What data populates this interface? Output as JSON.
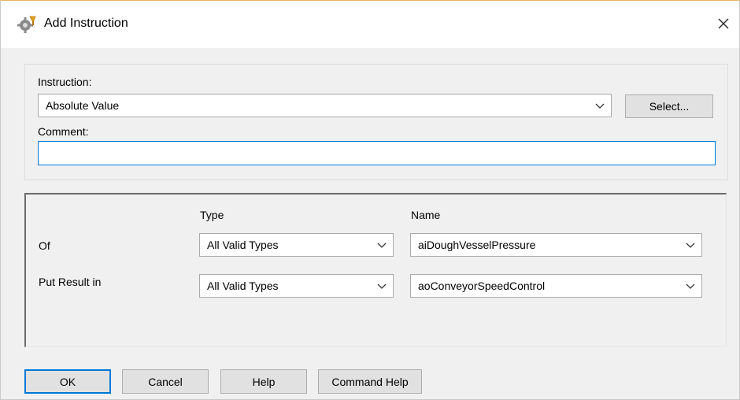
{
  "window": {
    "title": "Add Instruction",
    "icon": "instruction-gear-icon",
    "close_glyph": "✕"
  },
  "instruction_section": {
    "instruction_label": "Instruction:",
    "instruction_value": "Absolute Value",
    "select_button_label": "Select...",
    "comment_label": "Comment:",
    "comment_value": ""
  },
  "parameters": {
    "type_header": "Type",
    "name_header": "Name",
    "rows": [
      {
        "label": "Of",
        "type": "All Valid Types",
        "name": "aiDoughVesselPressure"
      },
      {
        "label": "Put Result in",
        "type": "All Valid Types",
        "name": "aoConveyorSpeedControl"
      }
    ]
  },
  "buttons": {
    "ok": "OK",
    "cancel": "Cancel",
    "help": "Help",
    "command_help": "Command Help"
  },
  "colors": {
    "focus_accent": "#0078d7",
    "dialog_background": "#f0f0f0"
  }
}
